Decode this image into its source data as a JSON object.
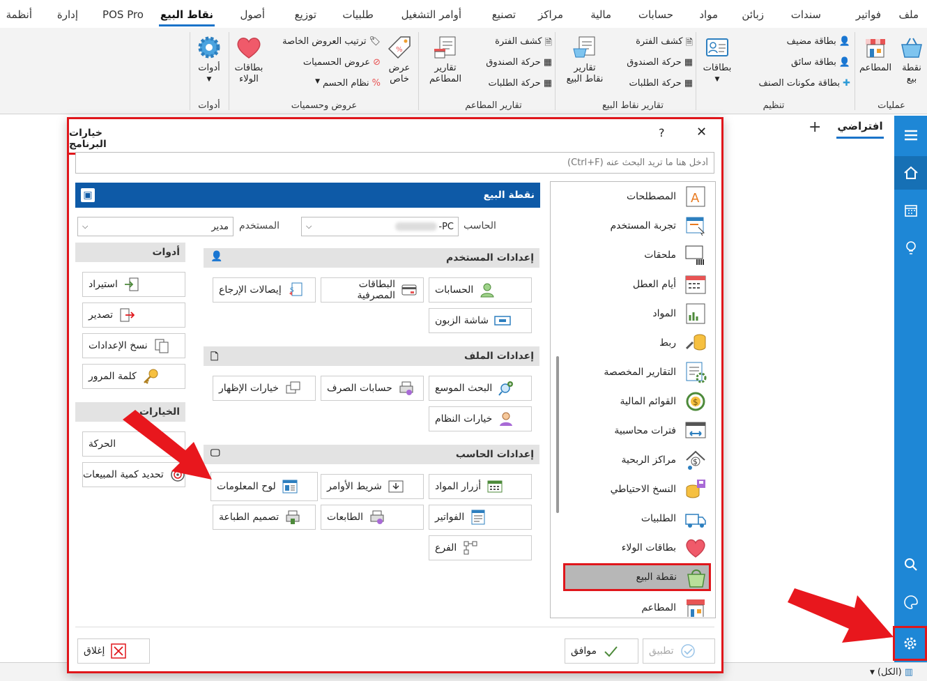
{
  "menu": {
    "items": [
      "ملف",
      "فواتير",
      "سندات",
      "زبائن",
      "مواد",
      "حسابات",
      "مالية",
      "مراكز",
      "تصنيع",
      "أوامر التشغيل",
      "طلبيات",
      "توزيع",
      "أصول",
      "نقاط البيع",
      "POS Pro",
      "إدارة",
      "أنظمة"
    ],
    "active": "نقاط البيع"
  },
  "ribbon": {
    "ops": {
      "label": "عمليات",
      "pos": "نقطة\nبيع",
      "restaurants": "المطاعم"
    },
    "org": {
      "label": "تنظيم",
      "guest": "بطاقة مضيف",
      "driver": "بطاقة سائق",
      "components": "بطاقة مكونات الصنف",
      "cards": "بطاقات"
    },
    "posreports": {
      "label": "تقارير نقاط البيع",
      "period": "كشف الفترة",
      "cashbox": "حركة الصندوق",
      "orders": "حركة الطلبات",
      "reports": "تقارير\nنقاط البيع"
    },
    "restreports": {
      "label": "تقارير المطاعم",
      "period": "كشف الفترة",
      "cashbox": "حركة الصندوق",
      "orders": "حركة الطلبات",
      "reports": "تقارير\nالمطاعم"
    },
    "offers": {
      "label": "عروض وحسميات",
      "sort": "ترتيب العروض الخاصة",
      "discounts": "عروض الحسميات",
      "system": "نظام الحسم",
      "special": "عرض\nخاص",
      "loyalty": "بطاقات\nالولاء"
    },
    "tools": {
      "label": "أدوات",
      "tools": "أدوات"
    }
  },
  "tabstrip": {
    "tab": "افتراضي",
    "add": "+"
  },
  "dialog": {
    "title": "خيارات البرنامج",
    "help": "?",
    "close": "✕",
    "search_placeholder": "أدخل هنا ما تريد البحث عنه (Ctrl+F)",
    "nav": [
      "المصطلحات",
      "تجربة المستخدم",
      "ملحقات",
      "أيام العطل",
      "المواد",
      "ربط",
      "التقارير المخصصة",
      "القوائم المالية",
      "فترات محاسبية",
      "مراكز الربحية",
      "النسخ الاحتياطي",
      "الطلبيات",
      "بطاقات الولاء",
      "نقطة البيع",
      "المطاعم"
    ],
    "header": "نقطة البيع",
    "computer_label": "الحاسب",
    "computer_value": "-PC",
    "user_label": "المستخدم",
    "user_value": "مدير",
    "sec_user": "إعدادات المستخدم",
    "sec_file": "إعدادات الملف",
    "sec_pc": "إعدادات الحاسب",
    "user_btns": {
      "accounts": "الحسابات",
      "bankcards": "البطاقات المصرفية",
      "returns": "إيصالات الإرجاع",
      "customer_screen": "شاشة الزبون"
    },
    "file_btns": {
      "search": "البحث الموسع",
      "exchange": "حسابات الصرف",
      "display": "خيارات الإظهار",
      "system": "خيارات النظام"
    },
    "pc_btns": {
      "items": "أزرار المواد",
      "toolbar": "شريط الأوامر",
      "dashboard": "لوح المعلومات",
      "invoices": "الفواتير",
      "printers": "الطابعات",
      "print_design": "تصميم الطباعة",
      "branch": "الفرع"
    },
    "tools_title": "أدوات",
    "tools": {
      "import": "استيراد",
      "export": "تصدير",
      "copy": "نسخ الإعدادات",
      "password": "كلمة المرور"
    },
    "options_title": "الخيارات",
    "options": {
      "movement": "الحركة",
      "sales_qty": "تحديد كمية المبيعات"
    },
    "apply": "تطبيق",
    "ok": "موافق",
    "closebtn": "إغلاق"
  },
  "status": {
    "filter": "(الكل)"
  }
}
